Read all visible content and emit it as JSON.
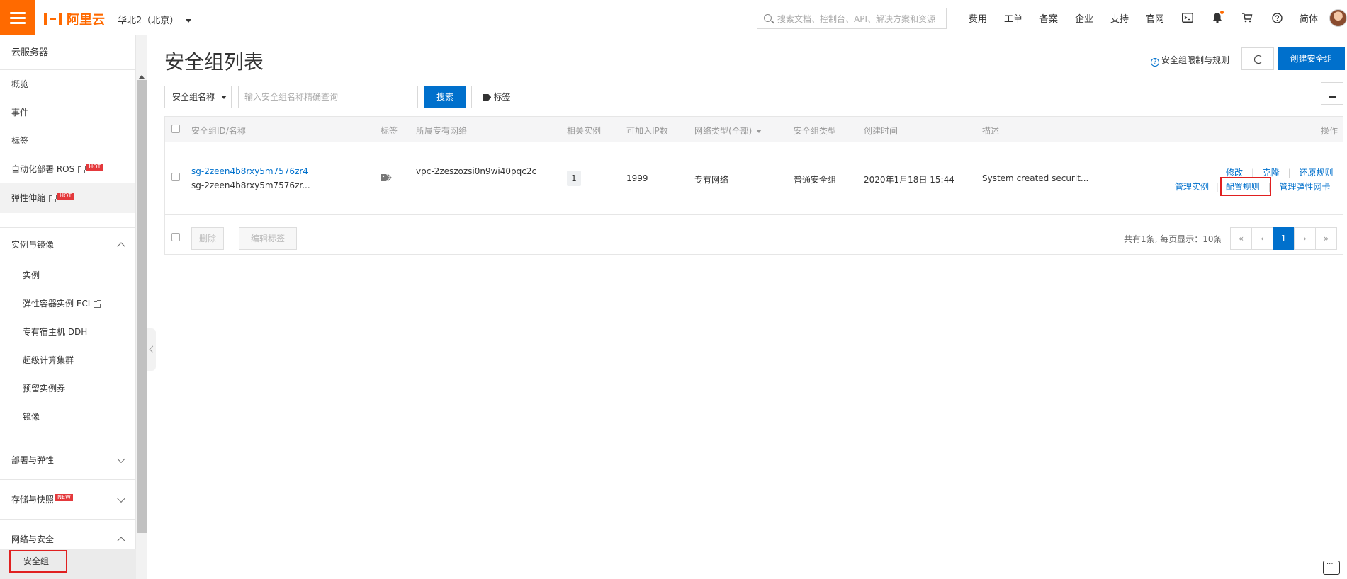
{
  "topbar": {
    "logo": "阿里云",
    "region": "华北2（北京）",
    "search_placeholder": "搜索文档、控制台、API、解决方案和资源",
    "nav": [
      "费用",
      "工单",
      "备案",
      "企业",
      "支持",
      "官网"
    ],
    "language": "简体"
  },
  "sidebar": {
    "title": "云服务器",
    "items": [
      {
        "label": "概览"
      },
      {
        "label": "事件"
      },
      {
        "label": "标签"
      },
      {
        "label": "自动化部署 ROS",
        "badge": "HOT"
      },
      {
        "label": "弹性伸缩",
        "badge": "HOT"
      }
    ],
    "group_instances": {
      "label": "实例与镜像",
      "items": [
        "实例",
        "弹性容器实例 ECI",
        "专有宿主机 DDH",
        "超级计算集群",
        "预留实例券",
        "镜像"
      ]
    },
    "group_deploy": "部署与弹性",
    "group_storage": {
      "label": "存储与快照",
      "badge": "NEW"
    },
    "group_network": {
      "label": "网络与安全",
      "active_item": "安全组"
    }
  },
  "page": {
    "title": "安全组列表",
    "help_link": "安全组限制与规则",
    "create_button": "创建安全组",
    "filter_select": "安全组名称",
    "filter_placeholder": "输入安全组名称精确查询",
    "search_button": "搜索",
    "tag_button": "标签"
  },
  "table": {
    "headers": [
      "安全组ID/名称",
      "标签",
      "所属专有网络",
      "相关实例",
      "可加入IP数",
      "网络类型(全部)",
      "安全组类型",
      "创建时间",
      "描述",
      "操作"
    ],
    "row": {
      "id": "sg-2zeen4b8rxy5m7576zr4",
      "name": "sg-2zeen4b8rxy5m7576zr...",
      "vpc": "vpc-2zeszozsi0n9wi40pqc2c",
      "instances": "1",
      "ip_count": "1999",
      "network_type": "专有网络",
      "sg_type": "普通安全组",
      "created": "2020年1月18日 15:44",
      "description": "System created securit...",
      "actions": {
        "modify": "修改",
        "clone": "克隆",
        "restore": "还原规则",
        "manage_instances": "管理实例",
        "configure_rules": "配置规则",
        "manage_eni": "管理弹性网卡"
      }
    },
    "footer": {
      "delete": "删除",
      "edit_tags": "编辑标签",
      "summary": "共有1条, 每页显示：10条",
      "pages": [
        "«",
        "‹",
        "1",
        "›",
        "»"
      ]
    }
  },
  "colors": {
    "brand": "#ff6a00",
    "primary": "#0070cc",
    "highlight": "#e02020"
  }
}
